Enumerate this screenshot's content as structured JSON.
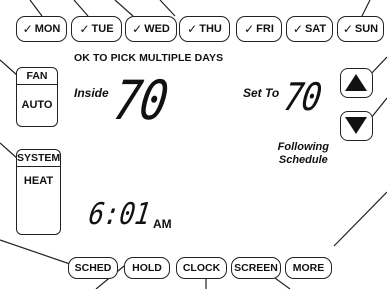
{
  "days": [
    {
      "check": "✓",
      "label": "MON"
    },
    {
      "check": "✓",
      "label": "TUE"
    },
    {
      "check": "✓",
      "label": "WED"
    },
    {
      "check": "✓",
      "label": "THU"
    },
    {
      "check": "✓",
      "label": "FRI"
    },
    {
      "check": "✓",
      "label": "SAT"
    },
    {
      "check": "✓",
      "label": "SUN"
    }
  ],
  "subtitle": "OK TO PICK MULTIPLE DAYS",
  "fan": {
    "title": "FAN",
    "value": "AUTO"
  },
  "system": {
    "title": "SYSTEM",
    "value": "HEAT"
  },
  "inside": {
    "label": "Inside",
    "temp": "70"
  },
  "setpoint": {
    "label": "Set To",
    "temp": "70"
  },
  "schedule_status": {
    "line1": "Following",
    "line2": "Schedule"
  },
  "clock": {
    "time": "6:01",
    "ampm": "AM"
  },
  "buttons": {
    "sched": "SCHED",
    "hold": "HOLD",
    "clock": "CLOCK",
    "screen": "SCREEN",
    "more": "MORE"
  },
  "icons": {
    "up": "up-arrow-icon",
    "down": "down-arrow-icon"
  }
}
